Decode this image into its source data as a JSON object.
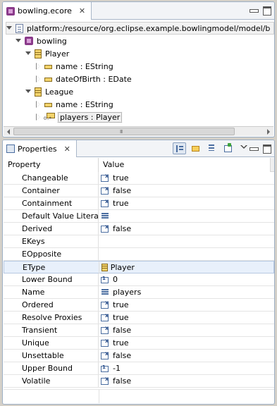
{
  "editor": {
    "tab_title": "bowling.ecore",
    "close_label": "✕",
    "tree": [
      {
        "label": "platform:/resource/org.eclipse.example.bowlingmodel/model/b",
        "icon": "file-icon",
        "level": 0,
        "toggle": "open",
        "kind": "resource"
      },
      {
        "label": "bowling",
        "icon": "package-icon",
        "level": 1,
        "toggle": "open",
        "kind": "package"
      },
      {
        "label": "Player",
        "icon": "class-icon",
        "level": 2,
        "toggle": "open",
        "kind": "class"
      },
      {
        "label": "name : EString",
        "icon": "attribute-icon",
        "level": 3,
        "toggle": "closed",
        "kind": "attribute"
      },
      {
        "label": "dateOfBirth : EDate",
        "icon": "attribute-icon",
        "level": 3,
        "toggle": "closed",
        "kind": "attribute"
      },
      {
        "label": "League",
        "icon": "class-icon",
        "level": 2,
        "toggle": "open",
        "kind": "class"
      },
      {
        "label": "name : EString",
        "icon": "attribute-icon",
        "level": 3,
        "toggle": "closed",
        "kind": "attribute"
      },
      {
        "label": "players : Player",
        "icon": "reference-icon",
        "level": 3,
        "toggle": "closed",
        "kind": "reference",
        "selected": true
      }
    ],
    "scroll_grip": "III"
  },
  "properties": {
    "tab_title": "Properties",
    "close_label": "✕",
    "toolbar_icons": [
      "show-categories-icon",
      "show-advanced-icon",
      "filter-icon",
      "restore-default-icon"
    ],
    "column_property": "Property",
    "column_value": "Value",
    "selected_row": "EType",
    "rows": [
      {
        "name": "Changeable",
        "value": "true",
        "icon": "bool"
      },
      {
        "name": "Container",
        "value": "false",
        "icon": "bool"
      },
      {
        "name": "Containment",
        "value": "true",
        "icon": "bool"
      },
      {
        "name": "Default Value Literal",
        "value": "",
        "icon": "text"
      },
      {
        "name": "Derived",
        "value": "false",
        "icon": "bool"
      },
      {
        "name": "EKeys",
        "value": "",
        "icon": "none"
      },
      {
        "name": "EOpposite",
        "value": "",
        "icon": "none"
      },
      {
        "name": "EType",
        "value": "Player",
        "icon": "class"
      },
      {
        "name": "Lower Bound",
        "value": "0",
        "icon": "num"
      },
      {
        "name": "Name",
        "value": "players",
        "icon": "text"
      },
      {
        "name": "Ordered",
        "value": "true",
        "icon": "bool"
      },
      {
        "name": "Resolve Proxies",
        "value": "true",
        "icon": "bool"
      },
      {
        "name": "Transient",
        "value": "false",
        "icon": "bool"
      },
      {
        "name": "Unique",
        "value": "true",
        "icon": "bool"
      },
      {
        "name": "Unsettable",
        "value": "false",
        "icon": "bool"
      },
      {
        "name": "Upper Bound",
        "value": "-1",
        "icon": "num"
      },
      {
        "name": "Volatile",
        "value": "false",
        "icon": "bool"
      }
    ]
  }
}
